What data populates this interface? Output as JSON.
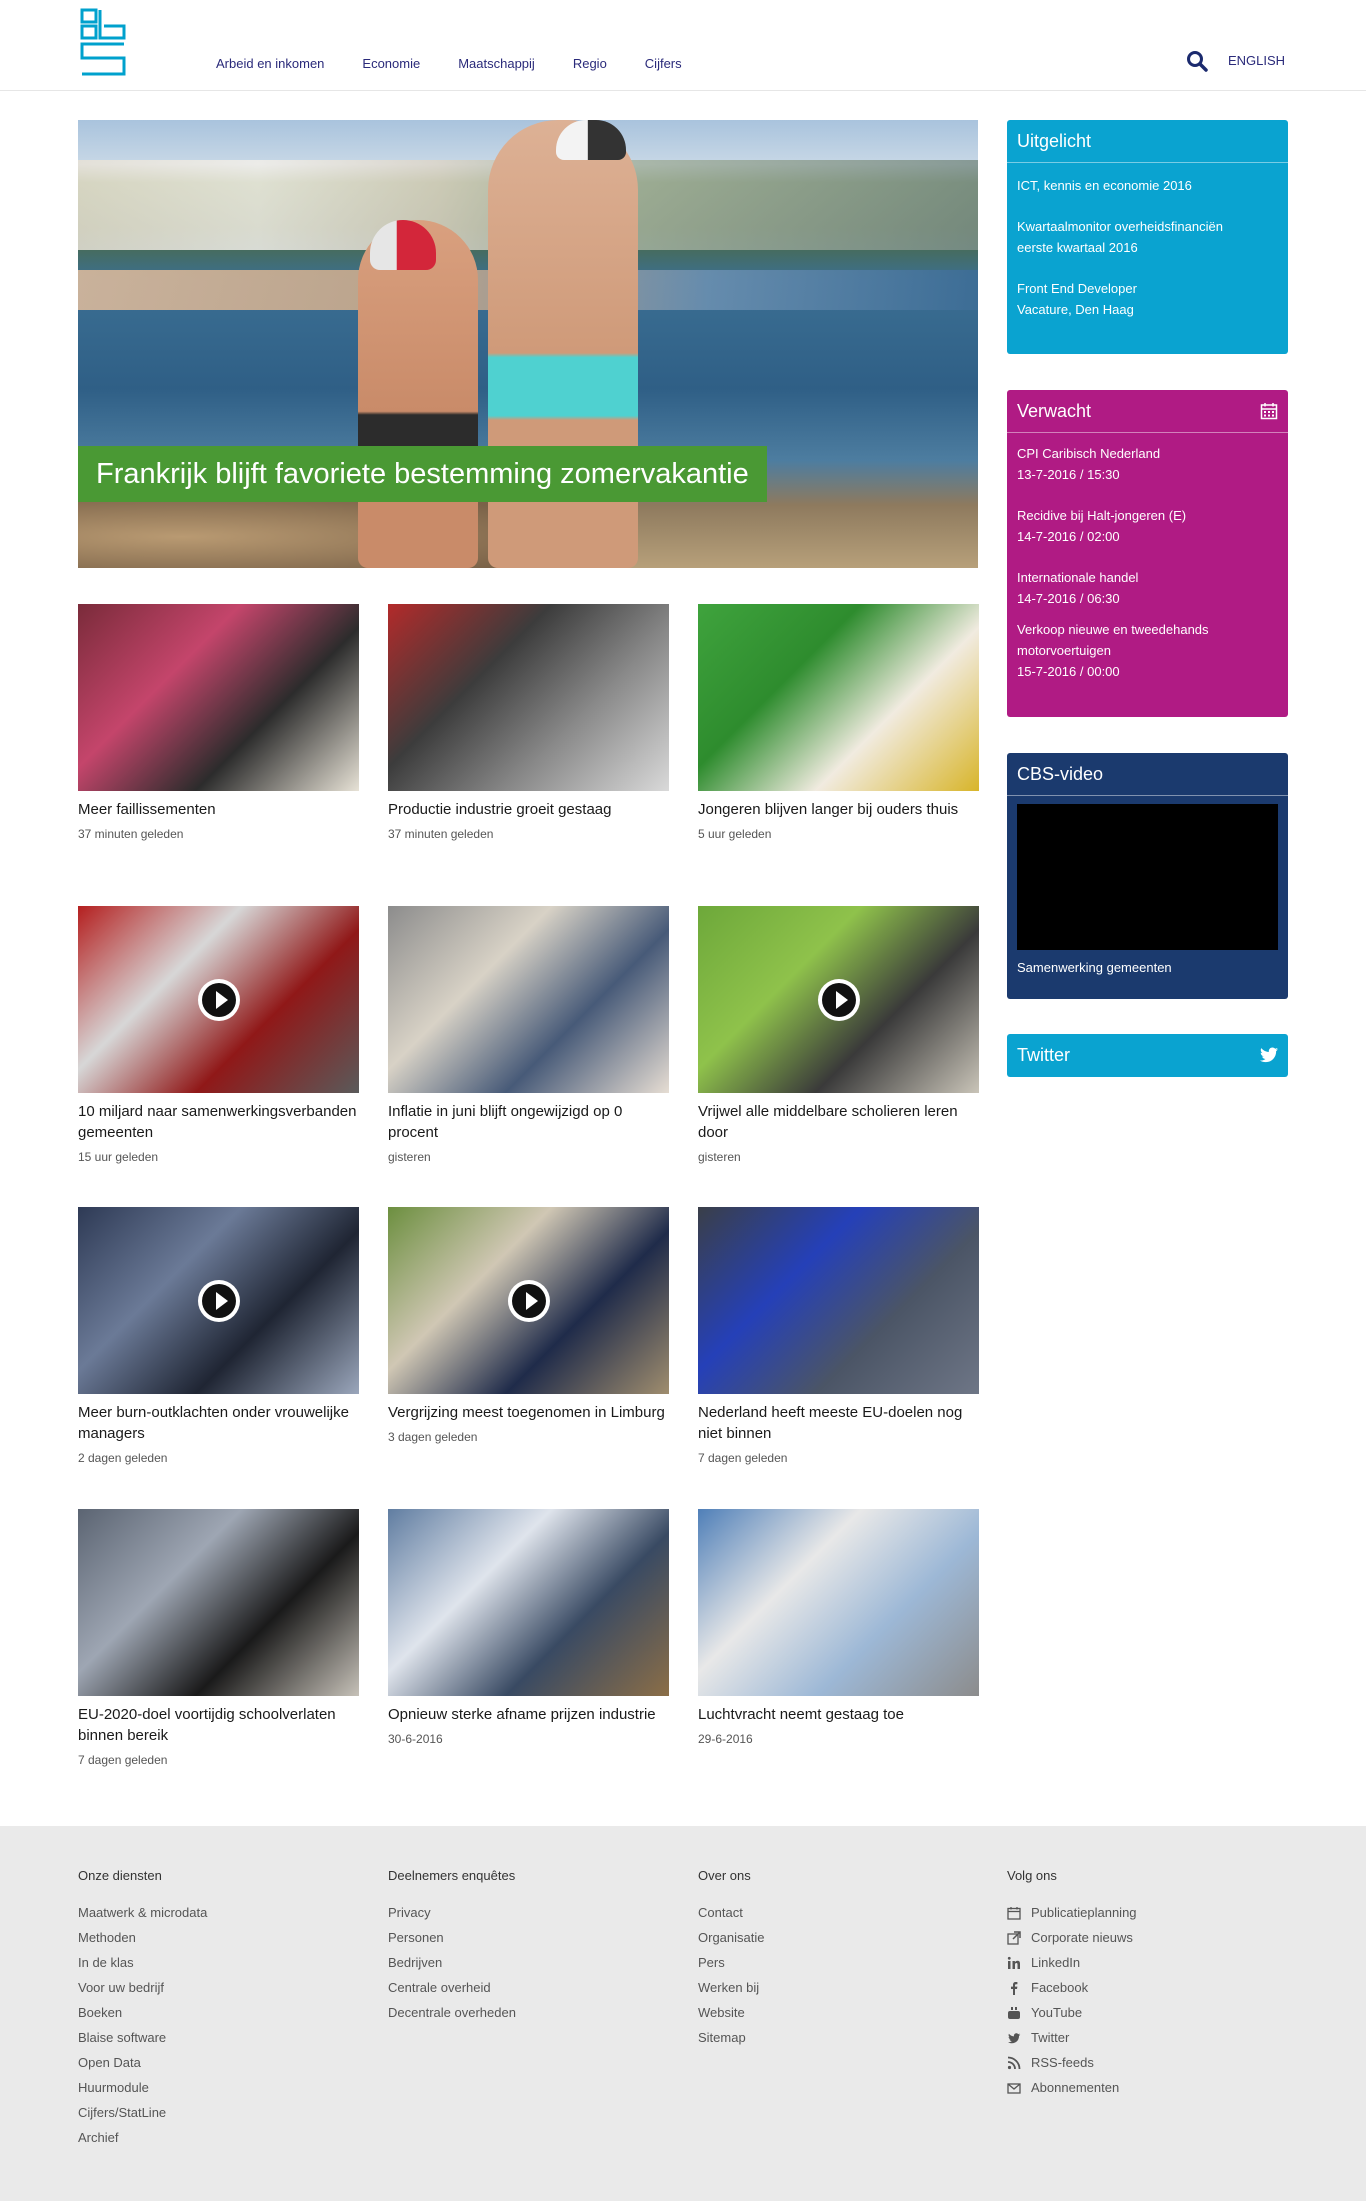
{
  "header": {
    "nav": [
      "Arbeid en inkomen",
      "Economie",
      "Maatschappij",
      "Regio",
      "Cijfers"
    ],
    "language_link": "ENGLISH"
  },
  "hero": {
    "caption": "Frankrijk blijft favoriete bestemming zomervakantie"
  },
  "news": [
    {
      "title": "Meer faillissementen",
      "time": "37 minuten geleden",
      "video": false
    },
    {
      "title": "Productie industrie groeit gestaag",
      "time": "37 minuten geleden",
      "video": false
    },
    {
      "title": "Jongeren blijven langer bij ouders thuis",
      "time": "5 uur geleden",
      "video": false
    },
    {
      "title": "10 miljard naar samenwerkingsverbanden gemeenten",
      "time": "15 uur geleden",
      "video": true
    },
    {
      "title": "Inflatie in juni blijft ongewijzigd op 0 procent",
      "time": "gisteren",
      "video": false
    },
    {
      "title": "Vrijwel alle middelbare scholieren leren door",
      "time": "gisteren",
      "video": true
    },
    {
      "title": "Meer burn-outklachten onder vrouwelijke managers",
      "time": "2 dagen geleden",
      "video": true
    },
    {
      "title": "Vergrijzing meest toegenomen in Limburg",
      "time": "3 dagen geleden",
      "video": true
    },
    {
      "title": "Nederland heeft meeste EU-doelen nog niet binnen",
      "time": "7 dagen geleden",
      "video": false
    },
    {
      "title": "EU-2020-doel voortijdig schoolverlaten binnen bereik",
      "time": "7 dagen geleden",
      "video": false
    },
    {
      "title": "Opnieuw sterke afname prijzen industrie",
      "time": "30-6-2016",
      "video": false
    },
    {
      "title": "Luchtvracht neemt gestaag toe",
      "time": "29-6-2016",
      "video": false
    }
  ],
  "sidebar": {
    "uitgelicht": {
      "title": "Uitgelicht",
      "items": [
        {
          "line1": "ICT, kennis en economie 2016",
          "line2": ""
        },
        {
          "line1": "Kwartaalmonitor overheidsfinanciën",
          "line2": "eerste kwartaal 2016"
        },
        {
          "line1": "Front End Developer",
          "line2": "Vacature, Den Haag"
        }
      ]
    },
    "verwacht": {
      "title": "Verwacht",
      "items": [
        {
          "title": "CPI Caribisch Nederland",
          "date": "13-7-2016 / 15:30"
        },
        {
          "title": "Recidive bij Halt-jongeren (E)",
          "date": "14-7-2016 / 02:00"
        },
        {
          "title": "Internationale handel",
          "date": "14-7-2016 / 06:30"
        },
        {
          "title": "Verkoop nieuwe en tweedehands motorvoertuigen",
          "date": "15-7-2016 / 00:00"
        }
      ]
    },
    "video": {
      "title": "CBS-video",
      "caption": "Samenwerking gemeenten"
    },
    "twitter": {
      "title": "Twitter"
    }
  },
  "footer": {
    "columns": [
      {
        "title": "Onze diensten",
        "links": [
          "Maatwerk & microdata",
          "Methoden",
          "In de klas",
          "Voor uw bedrijf",
          "Boeken",
          "Blaise software",
          "Open Data",
          "Huurmodule",
          "Cijfers/StatLine",
          "Archief"
        ]
      },
      {
        "title": "Deelnemers enquêtes",
        "links": [
          "Privacy",
          "Personen",
          "Bedrijven",
          "Centrale overheid",
          "Decentrale overheden"
        ]
      },
      {
        "title": "Over ons",
        "links": [
          "Contact",
          "Organisatie",
          "Pers",
          "Werken bij",
          "Website",
          "Sitemap"
        ]
      },
      {
        "title": "Volg ons",
        "links": [
          "Publicatieplanning",
          "Corporate nieuws",
          "LinkedIn",
          "Facebook",
          "YouTube",
          "Twitter",
          "RSS-feeds",
          "Abonnementen"
        ],
        "icons": [
          "calendar-icon",
          "external-link-icon",
          "linkedin-icon",
          "facebook-icon",
          "youtube-icon",
          "twitter-icon",
          "rss-icon",
          "envelope-icon"
        ]
      }
    ]
  },
  "colors": {
    "brand_blue": "#0aa3d0",
    "magenta": "#b01b84",
    "navy": "#1b3a6e",
    "green": "#4a9934",
    "nav_text": "#2a2a7a"
  }
}
